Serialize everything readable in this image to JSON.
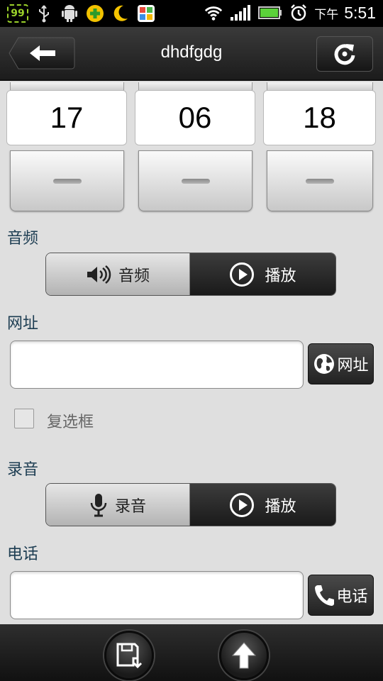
{
  "status_bar": {
    "battery_level": "99",
    "time_prefix": "下午",
    "time": "5:51"
  },
  "title_bar": {
    "title": "dhdfgdg"
  },
  "time_picker": {
    "hour": "17",
    "minute": "06",
    "second": "18"
  },
  "audio": {
    "section_label": "音频",
    "record_label": "音频",
    "play_label": "播放"
  },
  "url": {
    "section_label": "网址",
    "value": "",
    "button_label": "网址"
  },
  "checkbox": {
    "label": "复选框",
    "checked": false
  },
  "recording": {
    "section_label": "录音",
    "record_label": "录音",
    "play_label": "播放"
  },
  "phone": {
    "section_label": "电话",
    "value": "",
    "button_label": "电话"
  },
  "icons": [
    "usb-icon",
    "android-debug-icon",
    "plus-app-icon",
    "moon-icon",
    "gallery-app-icon",
    "wifi-icon",
    "signal-icon",
    "battery-icon",
    "alarm-icon",
    "back-arrow-icon",
    "refresh-icon",
    "speaker-icon",
    "play-icon",
    "globe-icon",
    "microphone-icon",
    "phone-icon",
    "save-icon",
    "upload-arrow-icon"
  ]
}
